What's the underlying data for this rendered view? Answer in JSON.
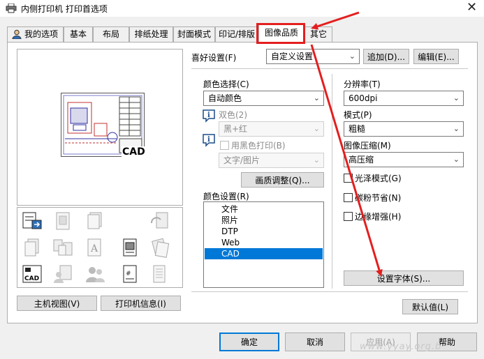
{
  "window": {
    "title": "内侧打印机 打印首选项",
    "close_glyph": "✕"
  },
  "tabs": [
    {
      "label": "我的选项",
      "icon": "user-icon"
    },
    {
      "label": "基本"
    },
    {
      "label": "布局"
    },
    {
      "label": "排纸处理"
    },
    {
      "label": "封面模式"
    },
    {
      "label": "印记/排版"
    },
    {
      "label": "图像品质",
      "active": true
    },
    {
      "label": "其它"
    }
  ],
  "preview": {
    "cad_label": "CAD"
  },
  "left_buttons": {
    "main_view": "主机视图(V)",
    "printer_info": "打印机信息(I)"
  },
  "favorites": {
    "label": "喜好设置(F)",
    "value": "自定义设置",
    "add": "追加(D)...",
    "edit": "编辑(E)..."
  },
  "color_select": {
    "label": "颜色选择(C)",
    "value": "自动颜色"
  },
  "dual_color": {
    "label": "双色(2)",
    "value": "黑+红"
  },
  "black_print": {
    "label": "用黑色打印(B)",
    "value": "文字/图片"
  },
  "quality_adjust": "画质调整(Q)...",
  "color_settings": {
    "label": "颜色设置(R)",
    "items": [
      "文件",
      "照片",
      "DTP",
      "Web",
      "CAD"
    ],
    "selected_index": 4
  },
  "resolution": {
    "label": "分辨率(T)",
    "value": "600dpi"
  },
  "mode": {
    "label": "模式(P)",
    "value": "粗糙"
  },
  "compression": {
    "label": "图像压缩(M)",
    "value": "高压缩"
  },
  "checkboxes": {
    "gloss": "光泽模式(G)",
    "toner_save": "碳粉节省(N)",
    "edge_enhance": "边缘增强(H)"
  },
  "set_font": "设置字体(S)...",
  "defaults": "默认值(L)",
  "footer": {
    "ok": "确定",
    "cancel": "取消",
    "apply": "应用(A)",
    "help": "帮助"
  },
  "watermark": "www.yyay.org.b",
  "colors": {
    "highlight": "#e41e1e",
    "selection": "#0078d7"
  }
}
